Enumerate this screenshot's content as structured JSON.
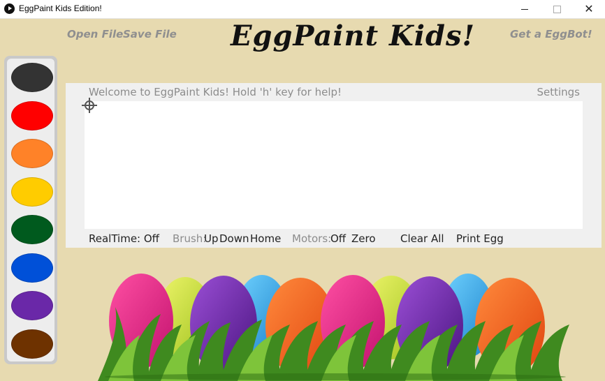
{
  "window": {
    "title": "EggPaint Kids Edition!",
    "close_glyph": "✕"
  },
  "header": {
    "open_file": "Open File",
    "save_file": "Save File",
    "app_title": "EggPaint Kids!",
    "get_eggbot": "Get a EggBot!"
  },
  "palette": {
    "colors": [
      "#333333",
      "#ff0000",
      "#ff8228",
      "#ffcc00",
      "#005a1e",
      "#0050d8",
      "#6a28a8",
      "#6e3200"
    ]
  },
  "canvas": {
    "welcome": "Welcome to EggPaint Kids!  Hold 'h' key for help!",
    "settings": "Settings"
  },
  "status": {
    "realtime": "RealTime: Off",
    "brush_label": "Brush:",
    "brush_up": "Up",
    "brush_down": "Down",
    "brush_home": "Home",
    "motors_label": "Motors:",
    "motors_off": "Off",
    "motors_zero": "Zero",
    "clear_all": "Clear All",
    "print_egg": "Print Egg"
  },
  "icons": {
    "app": "play-circle-icon",
    "cursor": "crosshair-icon"
  }
}
